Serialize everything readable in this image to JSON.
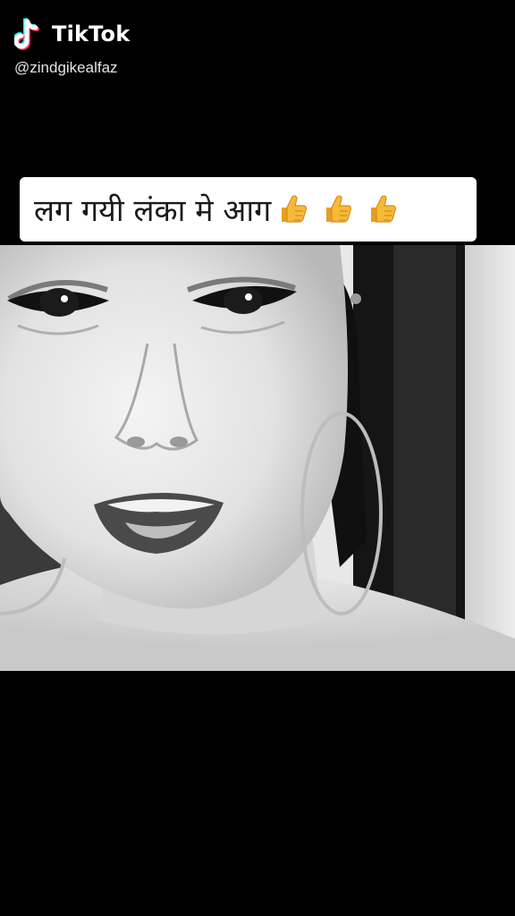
{
  "watermark": {
    "brand": "TikTok",
    "handle": "@zindgikealfaz",
    "logo_icon": "tiktok-note-icon"
  },
  "caption": {
    "text": "लग गयी लंका मे आग",
    "emoji": [
      "thumbs-up-icon",
      "thumbs-up-icon",
      "thumbs-up-icon"
    ]
  },
  "video": {
    "subject": "grayscale-face-frame",
    "style": "black-and-white"
  },
  "colors": {
    "background": "#000000",
    "caption_bg": "#ffffff",
    "caption_text": "#1a1a1a",
    "thumb": "#f6b93b",
    "tiktok_cyan": "#25f4ee",
    "tiktok_red": "#fe2c55"
  }
}
